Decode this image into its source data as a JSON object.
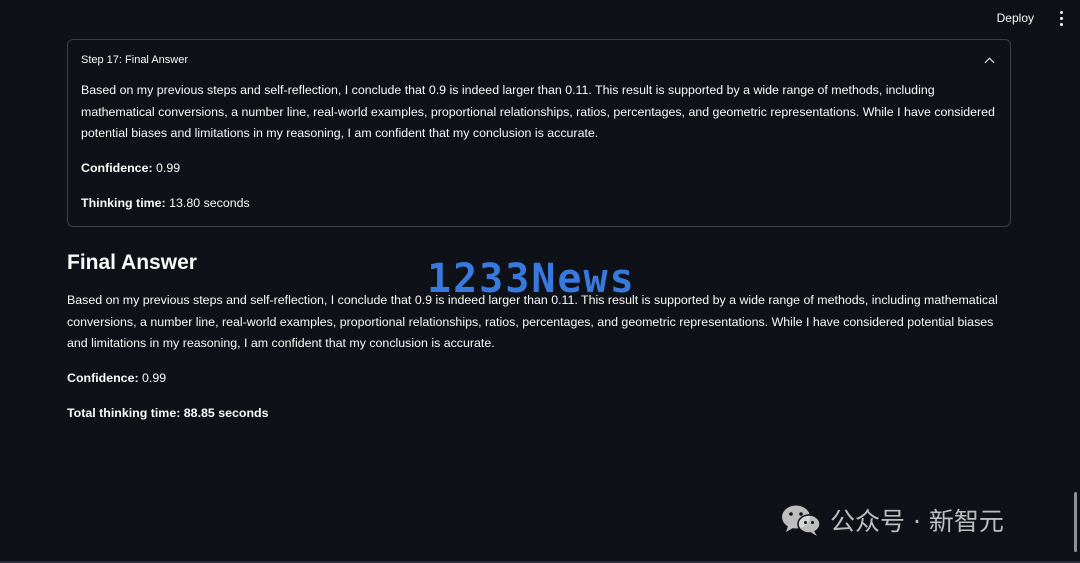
{
  "toolbar": {
    "deploy_label": "Deploy"
  },
  "expander": {
    "title": "Step 17: Final Answer",
    "body": "Based on my previous steps and self-reflection, I conclude that 0.9 is indeed larger than 0.11. This result is supported by a wide range of methods, including mathematical conversions, a number line, real-world examples, proportional relationships, ratios, percentages, and geometric representations. While I have considered potential biases and limitations in my reasoning, I am confident that my conclusion is accurate.",
    "confidence_label": "Confidence:",
    "confidence_value": " 0.99",
    "time_label": "Thinking time:",
    "time_value": " 13.80 seconds"
  },
  "final": {
    "heading": "Final Answer",
    "body": "Based on my previous steps and self-reflection, I conclude that 0.9 is indeed larger than 0.11. This result is supported by a wide range of methods, including mathematical conversions, a number line, real-world examples, proportional relationships, ratios, percentages, and geometric representations. While I have considered potential biases and limitations in my reasoning, I am confident that my conclusion is accurate.",
    "confidence_label": "Confidence:",
    "confidence_value": " 0.99",
    "total_time": "Total thinking time: 88.85 seconds"
  },
  "watermarks": {
    "news": "1233News",
    "wechat": "公众号 · 新智元"
  },
  "icons": {
    "menu": "kebab-menu-icon",
    "collapse": "chevron-up-icon",
    "wechat": "wechat-icon"
  },
  "colors": {
    "background": "#0e1117",
    "text": "#fafafa",
    "watermark_blue": "#3c82f0"
  }
}
